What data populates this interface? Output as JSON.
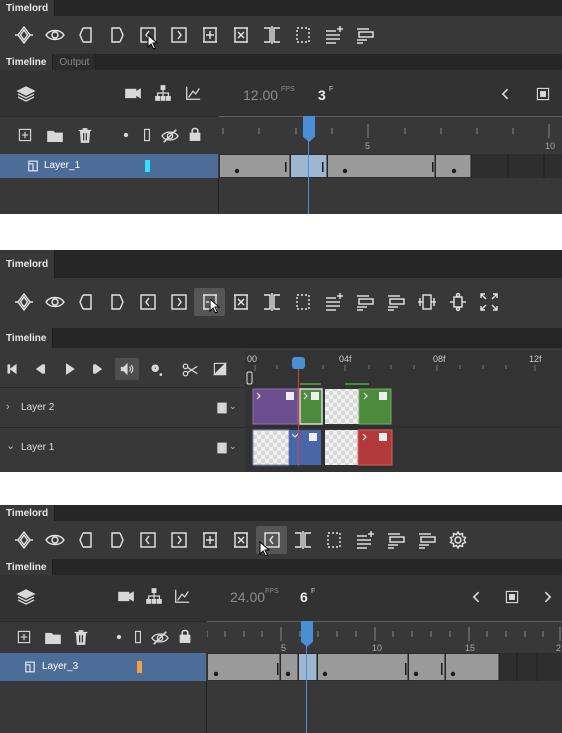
{
  "panel1": {
    "title_tab": "Timelord",
    "tabs": [
      "Timeline",
      "Output"
    ],
    "fps": "12.00",
    "fps_unit": "FPS",
    "frame": "3",
    "frame_unit": "F",
    "ruler_labels": [
      "5",
      "10"
    ],
    "layer_name": "Layer_1"
  },
  "panel2": {
    "title_tab": "Timelord",
    "tab": "Timeline",
    "ruler_labels": [
      "00",
      "04f",
      "08f",
      "12f"
    ],
    "layers": [
      "Layer 2",
      "Layer 1"
    ],
    "colors": {
      "purple": "#6b4f8f",
      "green": "#4e8a3e",
      "blue": "#4967a8",
      "red": "#b23a3a"
    }
  },
  "panel3": {
    "title_tab": "Timelord",
    "tab": "Timeline",
    "fps": "24.00",
    "fps_unit": "FPS",
    "frame": "6",
    "frame_unit": "F",
    "ruler_labels": [
      "5",
      "10",
      "15",
      "2"
    ],
    "layer_name": "Layer_3"
  },
  "colors": {
    "accent": "#4b6d97",
    "playhead": "#4a8fd6",
    "bar_gray": "#9a9a9a"
  }
}
